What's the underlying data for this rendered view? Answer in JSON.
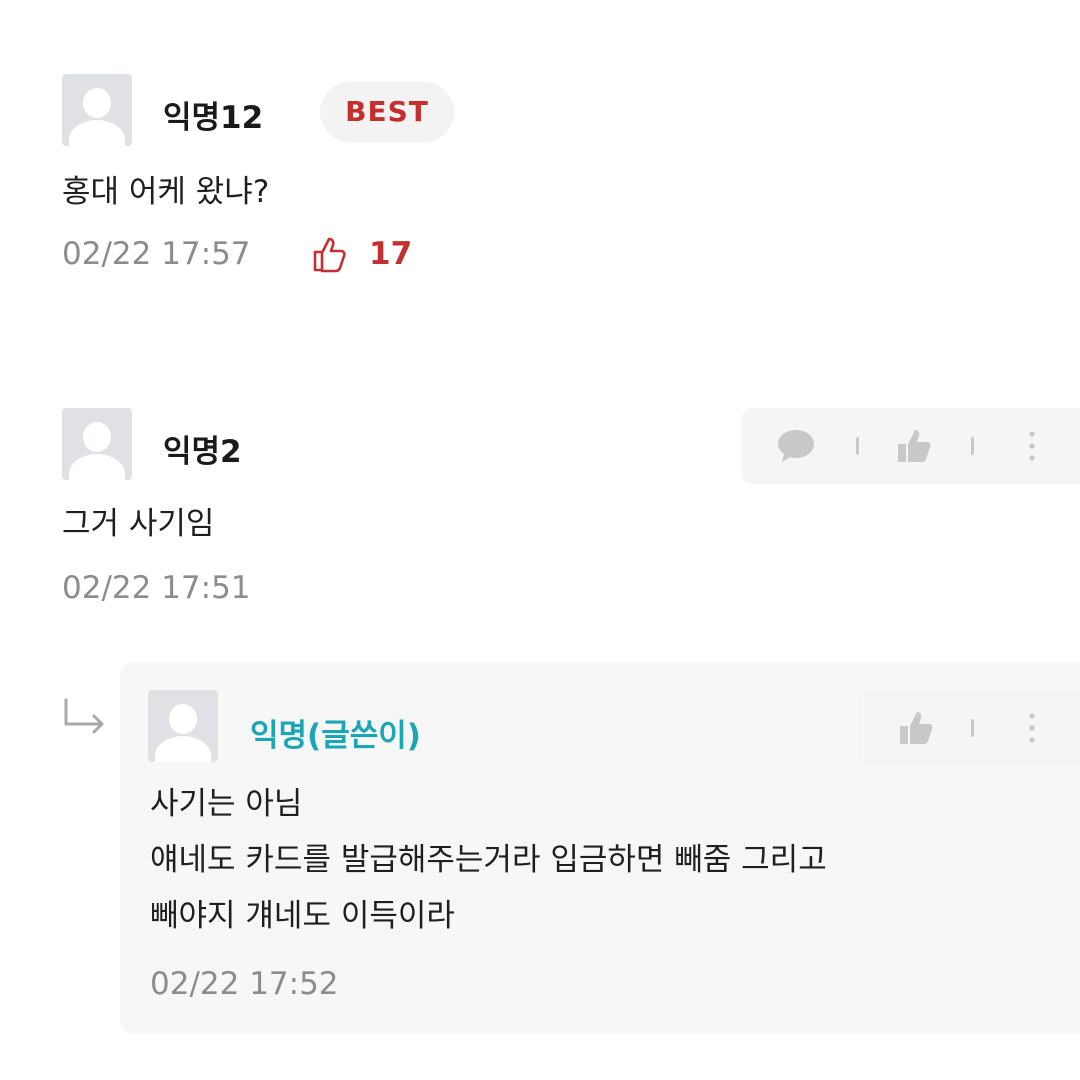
{
  "comments": [
    {
      "nickname": "익명12",
      "badge": "BEST",
      "text": "홍대 어케 왔냐?",
      "time": "02/22 17:57",
      "likes": "17"
    },
    {
      "nickname": "익명2",
      "text": "그거 사기임",
      "time": "02/22 17:51"
    }
  ],
  "reply": {
    "nickname": "익명(글쓴이)",
    "lines": [
      "사기는 아님",
      "얘네도 카드를 발급해주는거라 입금하면 빼줌 그리고",
      "빼야지 걔네도 이득이라"
    ],
    "time": "02/22 17:52"
  },
  "colors": {
    "best": "#c62f2f",
    "author": "#1aa6b3",
    "meta": "#8c8c8c",
    "icon": "#c8c8c8"
  },
  "icons": [
    "user-avatar-icon",
    "thumbs-up-icon",
    "speech-bubble-icon",
    "more-vertical-icon",
    "reply-arrow-icon"
  ]
}
